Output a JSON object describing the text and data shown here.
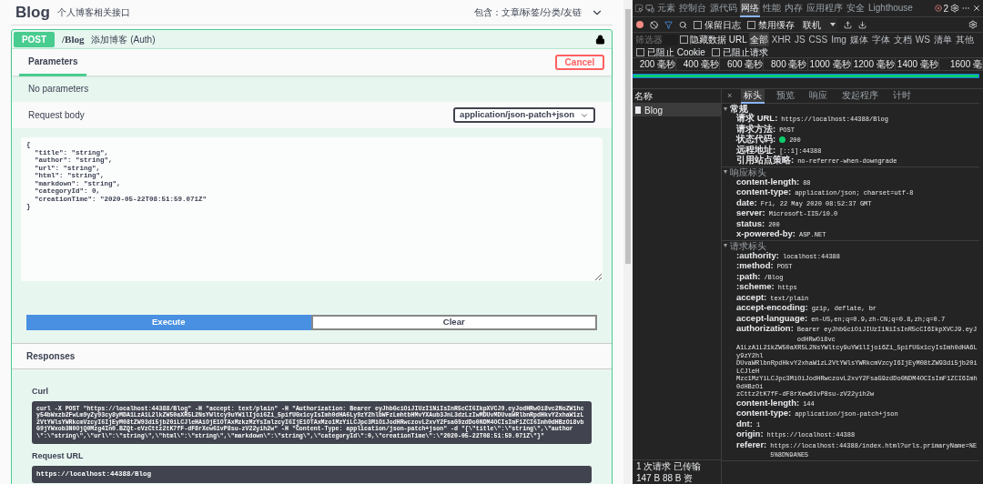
{
  "swagger": {
    "tag": {
      "title": "Blog",
      "description": "个人博客相关接口",
      "summary": "包含：文章/标签/分类/友链",
      "expanded": true
    },
    "operation": {
      "method": "POST",
      "path": "/Blog",
      "summary": "添加博客 (Auth)",
      "locked": true,
      "parameters_tab": {
        "label": "Parameters",
        "selected": true
      },
      "cancel": "Cancel",
      "no_parameters": "No parameters",
      "request_body": {
        "label": "Request body",
        "content_type": "application/json-patch+json",
        "value": "{\n  \"title\": \"string\",\n  \"author\": \"string\",\n  \"url\": \"string\",\n  \"html\": \"string\",\n  \"markdown\": \"string\",\n  \"categoryId\": 0,\n  \"creationTime\": \"2020-05-22T08:51:59.071Z\"\n}"
      },
      "buttons": [
        {
          "label": "Execute",
          "kind": "primary"
        },
        {
          "label": "Clear",
          "kind": "secondary"
        }
      ],
      "responses": {
        "title": "Responses",
        "curl_label": "Curl",
        "curl": "curl -X POST \"https://localhost:44388/Blog\" -H \"accept: text/plain\" -H \"Authorization: Bearer eyJhbGciOiJIUzI1NiIsInR5cCI6IkpXVCJ9.eyJodHRwOi8vc2NoZW1hcy54bWxzb2FwLm9yZy93cy8yMDA1LzA1L2lkZW50aXR5L2NsYWltcy9uYW1lIjoi6Zi_5pifUGx1cyIsImh0dHA6Ly9zY2hlbWFzLmhtbHMvYXAub3JnL3dzLzIwMDUvMDUvaWRlbnRpdHkvY2xhaW1zL2VtYWlsYWRkcmVzcyI6IjEyM08tZW93di5jb20iLCJleHAiOjE1OTAxMzkzMzYsImlzcyI6IjE1OTAxMzo1MzYiLCJpc3MiOiJodHRwczovL2xvY2FsaG9zdDo0NDM4OCIsImF1ZCI6Imh0dHBzOi8vbG9jYWxob3N0OjQ0Mzg4In0.BZQt-eVzCttz2tK7fF-dF8rXew61vP8su-zV22yih2w\" -H \"Content-Type: application/json-patch+json\" -d \"{\\\"title\\\":\\\"string\\\",\\\"author\\\":\\\"string\\\",\\\"url\\\":\\\"string\\\",\\\"html\\\":\\\"string\\\",\\\"markdown\\\":\\\"string\\\",\\\"categoryId\\\":0,\\\"creationTime\\\":\\\"2020-05-22T08:51:59.071Z\\\"}\"",
        "request_url_label": "Request URL",
        "request_url": "https://localhost:44388/Blog"
      }
    }
  },
  "devtools": {
    "tabs": [
      {
        "label": "元素",
        "selected": false
      },
      {
        "label": "控制台",
        "selected": false
      },
      {
        "label": "源代码",
        "selected": false
      },
      {
        "label": "网络",
        "selected": true
      },
      {
        "label": "性能",
        "selected": false
      },
      {
        "label": "内存",
        "selected": false
      },
      {
        "label": "应用程序",
        "selected": false
      },
      {
        "label": "安全",
        "selected": false
      },
      {
        "label": "Lighthouse",
        "selected": false
      }
    ],
    "error_count": "2",
    "toolbar": {
      "recording": true,
      "checkboxes": [
        {
          "label": "保留日志",
          "checked": false
        },
        {
          "label": "禁用缓存",
          "checked": false
        }
      ],
      "throttle": "联机"
    },
    "filter": {
      "placeholder": "筛选器",
      "hide_data_urls": {
        "label": "隐藏数据 URL",
        "checked": false
      },
      "types": [
        {
          "label": "全部",
          "selected": true
        },
        {
          "label": "XHR",
          "selected": false
        },
        {
          "label": "JS",
          "selected": false
        },
        {
          "label": "CSS",
          "selected": false
        },
        {
          "label": "Img",
          "selected": false
        },
        {
          "label": "媒体",
          "selected": false
        },
        {
          "label": "字体",
          "selected": false
        },
        {
          "label": "文档",
          "selected": false
        },
        {
          "label": "WS",
          "selected": false
        },
        {
          "label": "清单",
          "selected": false
        },
        {
          "label": "其他",
          "selected": false
        }
      ],
      "blocked": [
        {
          "label": "已阻止 Cookie",
          "checked": false
        },
        {
          "label": "已阻止请求",
          "checked": false
        }
      ]
    },
    "timeline_ticks": [
      "200 毫秒",
      "400 毫秒",
      "600 毫秒",
      "800 毫秒",
      "1000 毫秒",
      "1200 毫秒",
      "1400 毫秒",
      "1600 毫"
    ],
    "requests": {
      "header": "名称",
      "items": [
        {
          "name": "Blog",
          "selected": true
        }
      ]
    },
    "detail_tabs": [
      {
        "label": "×",
        "kind": "close"
      },
      {
        "label": "标头",
        "selected": true
      },
      {
        "label": "预览",
        "selected": false
      },
      {
        "label": "响应",
        "selected": false
      },
      {
        "label": "发起程序",
        "selected": false
      },
      {
        "label": "计时",
        "selected": false
      }
    ],
    "sections": [
      {
        "title": "常规",
        "expanded": true,
        "rows": [
          {
            "key": "请求 URL:",
            "value": "https://localhost:44388/Blog"
          },
          {
            "key": "请求方法:",
            "value": "POST"
          },
          {
            "key": "状态代码:",
            "value": "200",
            "kind": "status"
          },
          {
            "key": "远程地址:",
            "value": "[::1]:44388"
          },
          {
            "key": "引用站点策略:",
            "value": "no-referrer-when-downgrade"
          }
        ]
      },
      {
        "title": "响应标头",
        "expanded": true,
        "rows": [
          {
            "key": "content-length:",
            "value": "88"
          },
          {
            "key": "content-type:",
            "value": "application/json; charset=utf-8"
          },
          {
            "key": "date:",
            "value": "Fri, 22 May 2020 08:52:37 GMT"
          },
          {
            "key": "server:",
            "value": "Microsoft-IIS/10.0"
          },
          {
            "key": "status:",
            "value": "200"
          },
          {
            "key": "x-powered-by:",
            "value": "ASP.NET"
          }
        ]
      },
      {
        "title": "请求标头",
        "expanded": true,
        "rows": [
          {
            "key": ":authority:",
            "value": "localhost:44388"
          },
          {
            "key": ":method:",
            "value": "POST"
          },
          {
            "key": ":path:",
            "value": "/Blog"
          },
          {
            "key": ":scheme:",
            "value": "https"
          },
          {
            "key": "accept:",
            "value": "text/plain"
          },
          {
            "key": "accept-encoding:",
            "value": "gzip, deflate, br"
          },
          {
            "key": "accept-language:",
            "value": "en-US,en;q=0.9,zh-CN;q=0.8,zh;q=0.7"
          },
          {
            "key": "authorization:",
            "value": "Bearer eyJhbGciOiJIUzI1NiIsInR5cCI6IkpXVCJ9.eyJodHRwOi8vc",
            "kind": "multiline",
            "more": [
              "A1LzA1L21kZW50aXR5L2NsYWltcy9uYW1lIjoi6Zi_5pifUGx1cyIsImh0dHA6Ly9zY2hl",
              "DUvaWRlbnRpdHkvY2xhaW1zL2VtYWlsYWRkcmVzcyI6IjEyM08tZW93di5jb20iLCJleH",
              "Mzc1MzYiLCJpc3MiOiJodHRwczovL2xvY2FsaG9zdDo0NDM4OCIsImF1ZCI6Imh0dHBzOi",
              "zCttz2tK7fF-dF8rXew61vP8su-zV22yih2w"
            ]
          },
          {
            "key": "content-length:",
            "value": "144"
          },
          {
            "key": "content-type:",
            "value": "application/json-patch+json"
          },
          {
            "key": "dnt:",
            "value": "1"
          },
          {
            "key": "origin:",
            "value": "https://localhost:44388"
          },
          {
            "key": "referer:",
            "value": "https://localhost:44388/index.html?urls.primaryName=%E5%8D%9A%E5"
          }
        ]
      }
    ],
    "status_bar": "1 次请求  已传输 147 B  88 B 资"
  }
}
